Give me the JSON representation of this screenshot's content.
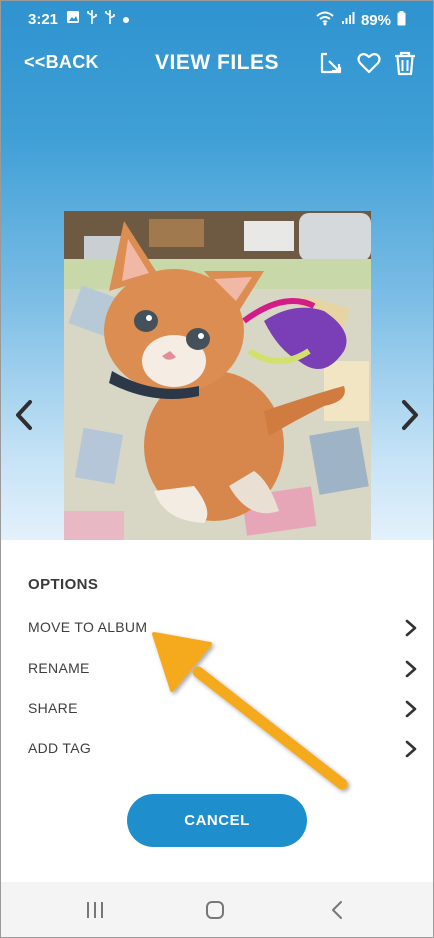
{
  "status_bar": {
    "time": "3:21",
    "battery": "89%",
    "left_icons": [
      "image-icon",
      "usb-icon",
      "usb-icon",
      "dot-icon"
    ],
    "right_icons": [
      "wifi-icon",
      "signal-icon",
      "battery-icon"
    ]
  },
  "header": {
    "back_label": "<<BACK",
    "title": "VIEW FILES",
    "icons": [
      "export-icon",
      "heart-icon",
      "trash-icon"
    ]
  },
  "viewer": {
    "prev_icon": "chevron-left-icon",
    "next_icon": "chevron-right-icon"
  },
  "options": {
    "heading": "OPTIONS",
    "items": [
      {
        "label": "MOVE TO ALBUM"
      },
      {
        "label": "RENAME"
      },
      {
        "label": "SHARE"
      },
      {
        "label": "ADD TAG"
      }
    ],
    "cancel_label": "CANCEL"
  },
  "navigation_bar": {
    "icons": [
      "recent-apps-icon",
      "home-icon",
      "back-icon"
    ]
  },
  "colors": {
    "header_blue": "#2f93cf",
    "button_blue": "#1e8fcc",
    "annotation_arrow": "#f5a91c"
  }
}
